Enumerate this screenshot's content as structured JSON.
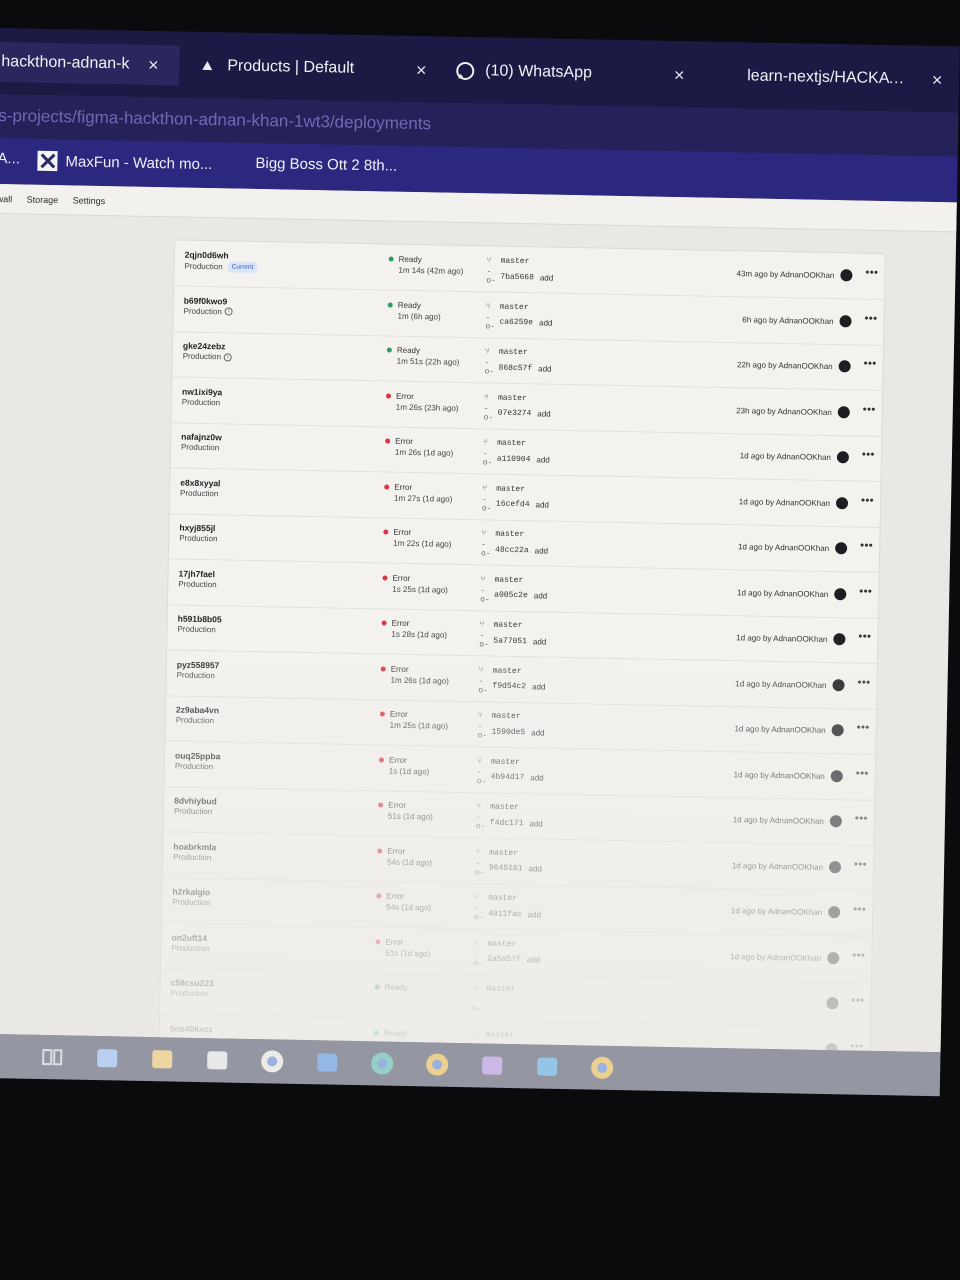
{
  "browser": {
    "tabs": [
      {
        "title": "hackthon-adnan-k",
        "icon": "vercel-triangle-icon",
        "active": true
      },
      {
        "title": "Products | Default",
        "icon": "vercel-triangle-icon",
        "active": false
      },
      {
        "title": "(10) WhatsApp",
        "icon": "whatsapp-icon",
        "active": false
      },
      {
        "title": "learn-nextjs/HACKATHON",
        "icon": "github-icon",
        "active": false
      }
    ],
    "close_glyph": "×",
    "url": "s-projects/figma-hackthon-adnan-khan-1wt3/deployments",
    "bookmarks": [
      {
        "label": "A..."
      },
      {
        "label": "MaxFun - Watch mo..."
      },
      {
        "label": "Bigg Boss Ott 2 8th..."
      }
    ]
  },
  "project_nav": [
    "wall",
    "Storage",
    "Settings"
  ],
  "deployments": [
    {
      "id": "2qjn0d6wh",
      "env": "Production",
      "current": "Current",
      "status": "Ready",
      "duration": "1m 14s (42m ago)",
      "branch": "master",
      "commit": "7ba5668",
      "message": "add",
      "time": "43m ago by AdnanOOKhan"
    },
    {
      "id": "b69f0kwo9",
      "env": "Production",
      "status": "Ready",
      "duration": "1m (6h ago)",
      "branch": "master",
      "commit": "ca6259e",
      "message": "add",
      "time": "6h ago by AdnanOOKhan"
    },
    {
      "id": "gke24zebz",
      "env": "Production",
      "status": "Ready",
      "duration": "1m 51s (22h ago)",
      "branch": "master",
      "commit": "868c57f",
      "message": "add",
      "time": "22h ago by AdnanOOKhan"
    },
    {
      "id": "nw1ixi9ya",
      "env": "Production",
      "status": "Error",
      "duration": "1m 26s (23h ago)",
      "branch": "master",
      "commit": "07e3274",
      "message": "add",
      "time": "23h ago by AdnanOOKhan"
    },
    {
      "id": "nafajnz0w",
      "env": "Production",
      "status": "Error",
      "duration": "1m 26s (1d ago)",
      "branch": "master",
      "commit": "a110904",
      "message": "add",
      "time": "1d ago by AdnanOOKhan"
    },
    {
      "id": "e8x8xyyal",
      "env": "Production",
      "status": "Error",
      "duration": "1m 27s (1d ago)",
      "branch": "master",
      "commit": "16cefd4",
      "message": "add",
      "time": "1d ago by AdnanOOKhan"
    },
    {
      "id": "hxyj855jl",
      "env": "Production",
      "status": "Error",
      "duration": "1m 22s (1d ago)",
      "branch": "master",
      "commit": "48cc22a",
      "message": "add",
      "time": "1d ago by AdnanOOKhan"
    },
    {
      "id": "17jh7fael",
      "env": "Production",
      "status": "Error",
      "duration": "1s 25s (1d ago)",
      "branch": "master",
      "commit": "a005c2e",
      "message": "add",
      "time": "1d ago by AdnanOOKhan"
    },
    {
      "id": "h591b8b05",
      "env": "Production",
      "status": "Error",
      "duration": "1s 28s (1d ago)",
      "branch": "master",
      "commit": "5a77051",
      "message": "add",
      "time": "1d ago by AdnanOOKhan"
    },
    {
      "id": "pyz558957",
      "env": "Production",
      "status": "Error",
      "duration": "1m 26s (1d ago)",
      "branch": "master",
      "commit": "f9d54c2",
      "message": "add",
      "time": "1d ago by AdnanOOKhan"
    },
    {
      "id": "2z9aba4vn",
      "env": "Production",
      "status": "Error",
      "duration": "1m 25s (1d ago)",
      "branch": "master",
      "commit": "1590de5",
      "message": "add",
      "time": "1d ago by AdnanOOKhan"
    },
    {
      "id": "ouq25ppba",
      "env": "Production",
      "status": "Error",
      "duration": "1s (1d ago)",
      "branch": "master",
      "commit": "4b94d17",
      "message": "add",
      "time": "1d ago by AdnanOOKhan"
    },
    {
      "id": "8dvhiybud",
      "env": "Production",
      "status": "Error",
      "duration": "51s (1d ago)",
      "branch": "master",
      "commit": "f4dc171",
      "message": "add",
      "time": "1d ago by AdnanOOKhan"
    },
    {
      "id": "hoabrkmla",
      "env": "Production",
      "status": "Error",
      "duration": "54s (1d ago)",
      "branch": "master",
      "commit": "9645161",
      "message": "add",
      "time": "1d ago by AdnanOOKhan"
    },
    {
      "id": "h2rkalgio",
      "env": "Production",
      "status": "Error",
      "duration": "54s (1d ago)",
      "branch": "master",
      "commit": "4911fac",
      "message": "add",
      "time": "1d ago by AdnanOOKhan"
    },
    {
      "id": "on2uft14",
      "env": "Production",
      "status": "Error",
      "duration": "51s (1d ago)",
      "branch": "master",
      "commit": "2a5a57f",
      "message": "add",
      "time": "1d ago by AdnanOOKhan"
    },
    {
      "id": "c58csu223",
      "env": "Production",
      "status": "Ready",
      "duration": "",
      "branch": "master",
      "commit": "",
      "message": "",
      "time": ""
    },
    {
      "id": "5no40kxcz",
      "env": "",
      "status": "Ready",
      "duration": "",
      "branch": "master",
      "commit": "",
      "message": "",
      "time": ""
    }
  ],
  "colors": {
    "ready": "#2f9e62",
    "error": "#d9363e",
    "tab_bar": "#1c1a44",
    "bookmarks_bar": "#2c2880"
  },
  "taskbar": {
    "icons": [
      "task-view-icon",
      "copilot-icon",
      "file-explorer-icon",
      "store-icon",
      "chatgpt-icon",
      "outlook-icon",
      "edge-icon",
      "chrome-icon",
      "visual-studio-icon",
      "vscode-icon",
      "chrome-icon"
    ]
  }
}
